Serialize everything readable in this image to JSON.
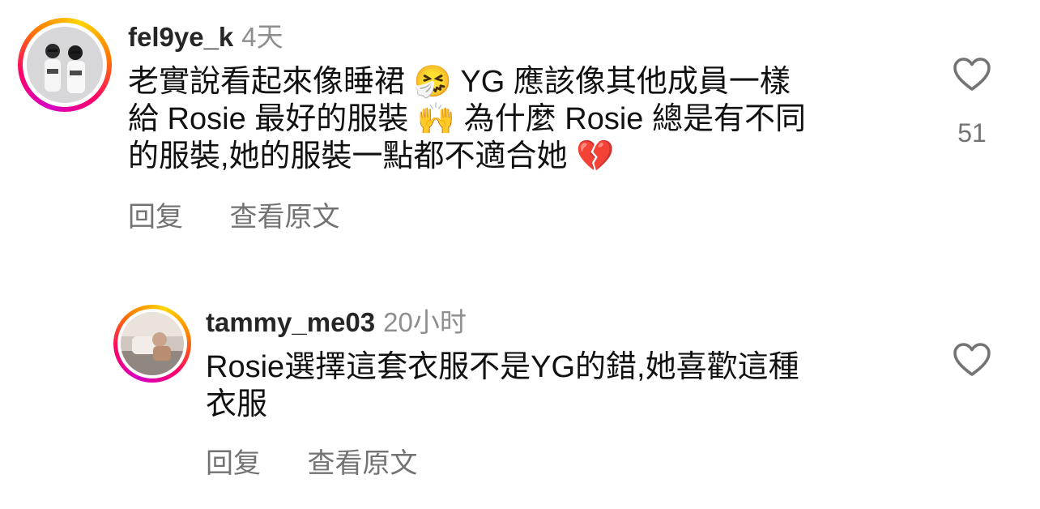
{
  "comments": [
    {
      "username": "fel9ye_k",
      "time": "4天",
      "text_line1": "老實說看起來像睡裙 🤧 YG 應該像其他成員一樣",
      "text_line2": "給 Rosie 最好的服裝 🙌 為什麼 Rosie 總是有不同",
      "text_line3": "的服裝,她的服裝一點都不適合她 💔",
      "reply_label": "回复",
      "translate_label": "查看原文",
      "likes": "51"
    },
    {
      "username": "tammy_me03",
      "time": "20小时",
      "text_line1": "Rosie選擇這套衣服不是YG的錯,她喜歡這種",
      "text_line2": "衣服",
      "reply_label": "回复",
      "translate_label": "查看原文"
    }
  ],
  "colors": {
    "text": "#111111",
    "secondary": "#737373",
    "ring_gradient": [
      "#d300c5",
      "#ff0069",
      "#ff7a00",
      "#ffd600"
    ]
  },
  "icons": [
    "heart-outline-icon"
  ]
}
